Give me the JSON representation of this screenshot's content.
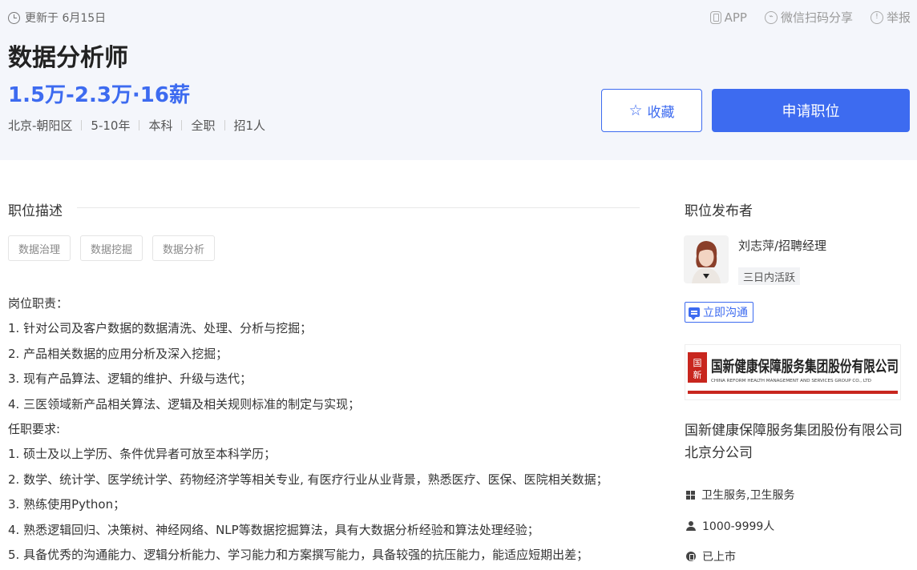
{
  "header": {
    "updated": "更新于 6月15日",
    "links": {
      "app": "APP",
      "wechat_share": "微信扫码分享",
      "report": "举报"
    }
  },
  "job": {
    "title": "数据分析师",
    "salary": "1.5万-2.3万·16薪",
    "meta": [
      "北京-朝阳区",
      "5-10年",
      "本科",
      "全职",
      "招1人"
    ]
  },
  "actions": {
    "favorite": "收藏",
    "apply": "申请职位"
  },
  "description": {
    "section_title": "职位描述",
    "tags": [
      "数据治理",
      "数据挖掘",
      "数据分析"
    ],
    "lines": [
      "岗位职责：",
      "1. 针对公司及客户数据的数据清洗、处理、分析与挖掘；",
      "2. 产品相关数据的应用分析及深入挖掘；",
      "3. 现有产品算法、逻辑的维护、升级与迭代；",
      "4. 三医领域新产品相关算法、逻辑及相关规则标准的制定与实现；",
      "任职要求:",
      "1. 硕士及以上学历、条件优异者可放至本科学历；",
      "2. 数学、统计学、医学统计学、药物经济学等相关专业, 有医疗行业从业背景，熟悉医疗、医保、医院相关数据；",
      "3. 熟练使用Python；",
      "4. 熟悉逻辑回归、决策树、神经网络、NLP等数据挖掘算法，具有大数据分析经验和算法处理经验；",
      "5. 具备优秀的沟通能力、逻辑分析能力、学习能力和方案撰写能力，具备较强的抗压能力，能适应短期出差；"
    ]
  },
  "publisher": {
    "section_title": "职位发布者",
    "name": "刘志萍/招聘经理",
    "activity": "三日内活跃",
    "chat": "立即沟通"
  },
  "company": {
    "logo_text": "国新健康保障服务集团股份有限公司",
    "logo_seal": "国新",
    "logo_subtext": "CHINA REFORM HEALTH MANAGEMENT AND SERVICES GROUP CO., LTD",
    "name": "国新健康保障服务集团股份有限公司北京分公司",
    "industry": "卫生服务,卫生服务",
    "size": "1000-9999人",
    "financing": "已上市"
  },
  "colors": {
    "accent": "#3d6bf0",
    "logo_red": "#c8261e"
  }
}
